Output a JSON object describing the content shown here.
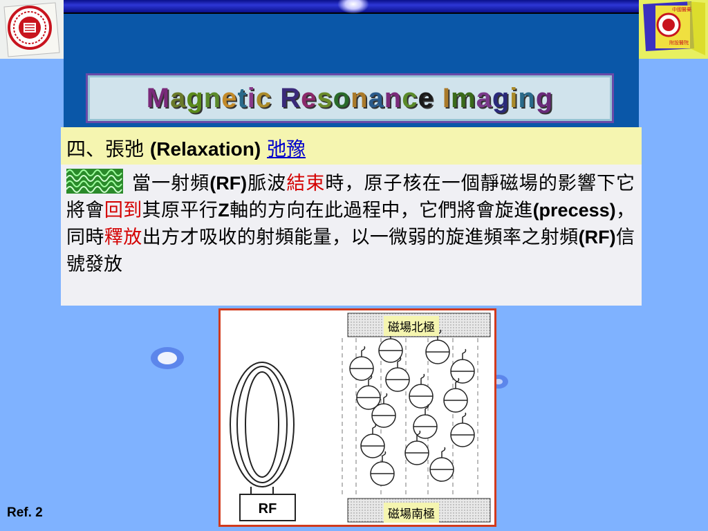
{
  "title": {
    "text": "Magnetic Resonance Imaging",
    "letter_colors": [
      "#7a2a7a",
      "#6a7a2a",
      "#5a8a1a",
      "#5b8a2b",
      "#c28a2a",
      "#2a6a8a",
      "#8a3a8a",
      "#aa8a2a",
      "#3a2a7a",
      "#8a2a6a",
      "#6a8a2a",
      "#2a6a2a",
      "#aa7a2a",
      "#2a5a8a",
      "#7a2a7a",
      "#5a8a2a",
      "#1a1a1a",
      "#aa7a2a",
      "#3a6a1a",
      "#7a3a8a",
      "#2a2a7a",
      "#aa8a2a",
      "#2a6a8a",
      "#6a2a7a",
      "#3a7a1a",
      "#aa8a1a"
    ]
  },
  "heading": {
    "prefix": "四、張弛 ",
    "english": "(Relaxation)",
    "link": "弛豫"
  },
  "body": {
    "s1": "當一射頻",
    "s2": "(RF)",
    "s3": "脈波",
    "s4": "結束",
    "s5": "時，原子核在一個靜磁場的影響下它將會",
    "s6": "回到",
    "s7": "其原平行",
    "s8": "Z",
    "s9": "軸的方向在此過程中，它們將會旋進",
    "s10": "(precess)",
    "s11": "，同時",
    "s12": "釋放",
    "s13": "出方才吸收的射頻能量，以一微弱的旋進頻率之射頻",
    "s14": "(RF)",
    "s15": "信號發放"
  },
  "figure": {
    "north_label": "磁場北極",
    "south_label": "磁場南極",
    "rf_label": "RF"
  },
  "ref": "Ref. 2",
  "colors": {
    "background": "#7fb2ff",
    "band": "#0a57a8",
    "heading_bg": "#f5f5b0",
    "accent_red": "#d40000",
    "link": "#0000cc",
    "figure_border": "#d23a1c"
  }
}
